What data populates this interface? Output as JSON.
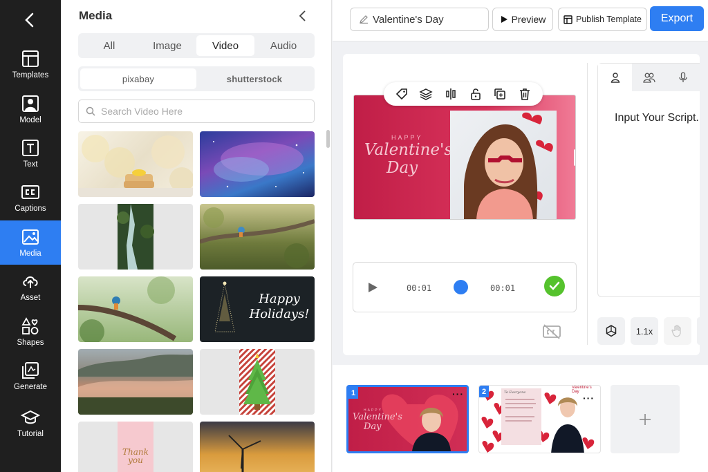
{
  "nav": {
    "items": [
      {
        "label": "Templates",
        "icon": "templates-icon"
      },
      {
        "label": "Model",
        "icon": "model-icon"
      },
      {
        "label": "Text",
        "icon": "text-icon"
      },
      {
        "label": "Captions",
        "icon": "captions-icon"
      },
      {
        "label": "Media",
        "icon": "media-icon",
        "active": true
      },
      {
        "label": "Asset",
        "icon": "asset-icon"
      },
      {
        "label": "Shapes",
        "icon": "shapes-icon"
      },
      {
        "label": "Generate",
        "icon": "generate-icon"
      },
      {
        "label": "Tutorial",
        "icon": "tutorial-icon"
      }
    ]
  },
  "media": {
    "title": "Media",
    "tabs": [
      "All",
      "Image",
      "Video",
      "Audio"
    ],
    "active_tab": "Video",
    "sources": [
      "pixabay",
      "shutterstock"
    ],
    "active_source": "pixabay",
    "search_placeholder": "Search Video Here",
    "thumb_text": {
      "holidays": "Happy Holidays!"
    }
  },
  "topbar": {
    "project_title": "Valentine's Day",
    "preview_label": "Preview",
    "publish_label": "Publish Template",
    "export_label": "Export"
  },
  "stage": {
    "happy_text": "HAPPY",
    "valentine_text": "Valentine's",
    "day_text": "Day"
  },
  "player": {
    "current_time": "00:01",
    "total_time": "00:01"
  },
  "script": {
    "placeholder": "Input Your Script.",
    "speed_label": "1.1x"
  },
  "slides": [
    {
      "number": "1",
      "happy": "HAPPY",
      "title": "Valentine's",
      "day": "Day"
    },
    {
      "number": "2",
      "title": "Valentine's Day",
      "subtitle": "To Everyone"
    }
  ],
  "colors": {
    "accent": "#2e7ef2",
    "nav_bg": "#1f1f1f",
    "success": "#55c22d"
  }
}
